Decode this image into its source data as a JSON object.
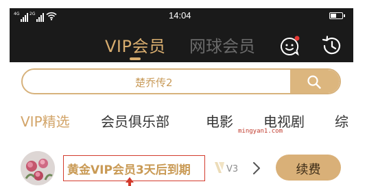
{
  "status_bar": {
    "time": "14:04",
    "signal1_label": "4G",
    "signal2_label": "2G"
  },
  "header": {
    "tab_vip": "VIP会员",
    "tab_tennis": "网球会员",
    "icons": [
      "message-icon",
      "history-icon"
    ],
    "notification_dot_color": "#e53935"
  },
  "search": {
    "placeholder": "楚乔传2",
    "button_icon": "search-icon"
  },
  "categories": [
    {
      "label": "VIP精选",
      "active": true
    },
    {
      "label": "会员俱乐部"
    },
    {
      "label": "电影"
    },
    {
      "label": "电视剧"
    },
    {
      "label": "综"
    }
  ],
  "watermark": "mingyan1.com",
  "member": {
    "expire_notice": "黄金VIP会员3天后到期",
    "level": "V3",
    "renew_label": "续费"
  },
  "colors": {
    "gold": "#d8ad6f",
    "header_bg": "#1a1a1a",
    "highlight_border": "#d33a2c"
  }
}
